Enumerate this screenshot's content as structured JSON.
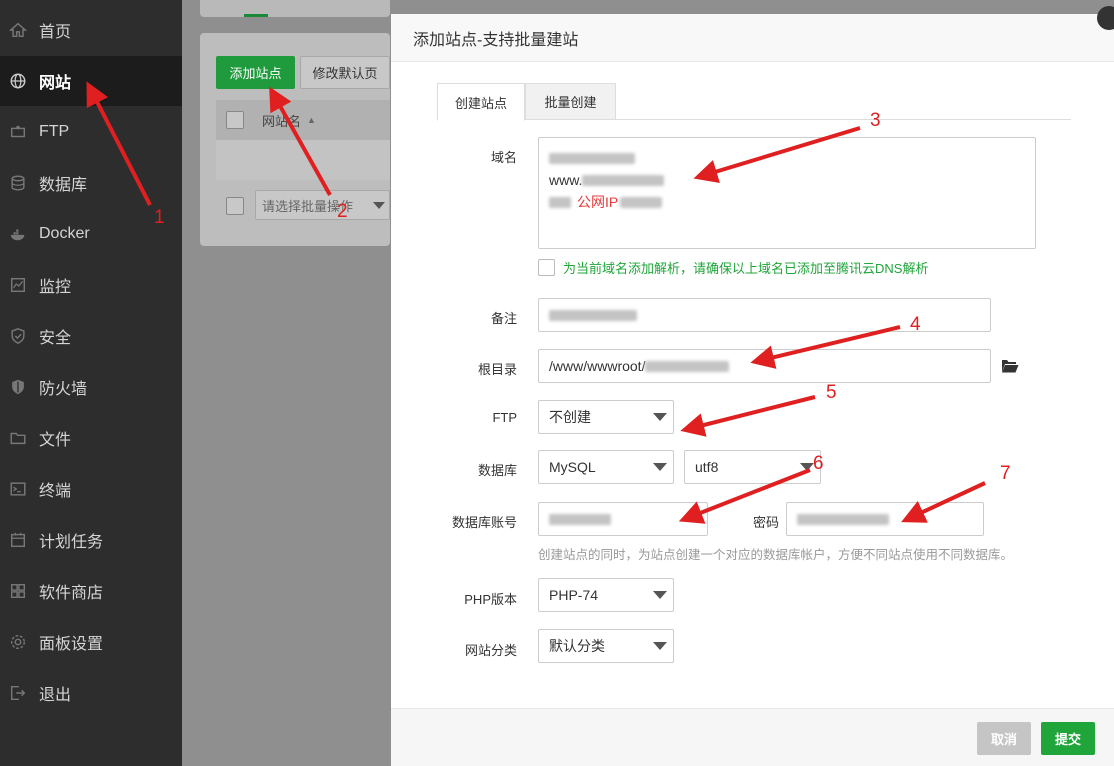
{
  "sidebar": {
    "items": [
      {
        "label": "首页",
        "icon": "home-icon"
      },
      {
        "label": "网站",
        "icon": "globe-icon",
        "active": true
      },
      {
        "label": "FTP",
        "icon": "ftp-icon"
      },
      {
        "label": "数据库",
        "icon": "database-icon"
      },
      {
        "label": "Docker",
        "icon": "docker-icon"
      },
      {
        "label": "监控",
        "icon": "monitor-icon"
      },
      {
        "label": "安全",
        "icon": "shield-icon"
      },
      {
        "label": "防火墙",
        "icon": "firewall-icon"
      },
      {
        "label": "文件",
        "icon": "folder-icon"
      },
      {
        "label": "终端",
        "icon": "terminal-icon"
      },
      {
        "label": "计划任务",
        "icon": "calendar-icon"
      },
      {
        "label": "软件商店",
        "icon": "apps-icon"
      },
      {
        "label": "面板设置",
        "icon": "gear-icon"
      },
      {
        "label": "退出",
        "icon": "logout-icon"
      }
    ]
  },
  "background": {
    "add_site_label": "添加站点",
    "default_page_label": "修改默认页",
    "table_header_name": "网站名",
    "batch_placeholder": "请选择批量操作"
  },
  "modal": {
    "title": "添加站点-支持批量建站",
    "tabs": [
      {
        "label": "创建站点",
        "active": true
      },
      {
        "label": "批量创建",
        "active": false
      }
    ],
    "domain_label": "域名",
    "domain_lines": [
      "www.",
      "公网IP"
    ],
    "dns_checkbox_label": "为当前域名添加解析，请确保以上域名已添加至腾讯云DNS解析",
    "remark_label": "备注",
    "root_label": "根目录",
    "root_value": "/www/wwwroot/",
    "ftp_label": "FTP",
    "ftp_value": "不创建",
    "db_label": "数据库",
    "db_value": "MySQL",
    "db_charset": "utf8",
    "db_account_label": "数据库账号",
    "password_label": "密码",
    "db_hint": "创建站点的同时，为站点创建一个对应的数据库帐户，方便不同站点使用不同数据库。",
    "php_label": "PHP版本",
    "php_value": "PHP-74",
    "category_label": "网站分类",
    "category_value": "默认分类",
    "cancel_label": "取消",
    "submit_label": "提交"
  },
  "annotations": {
    "numbers": [
      "1",
      "2",
      "3",
      "4",
      "5",
      "6",
      "7"
    ],
    "color": "#e02020"
  },
  "colors": {
    "accent": "#20a53a",
    "sidebar_bg": "#2d2d2d"
  }
}
